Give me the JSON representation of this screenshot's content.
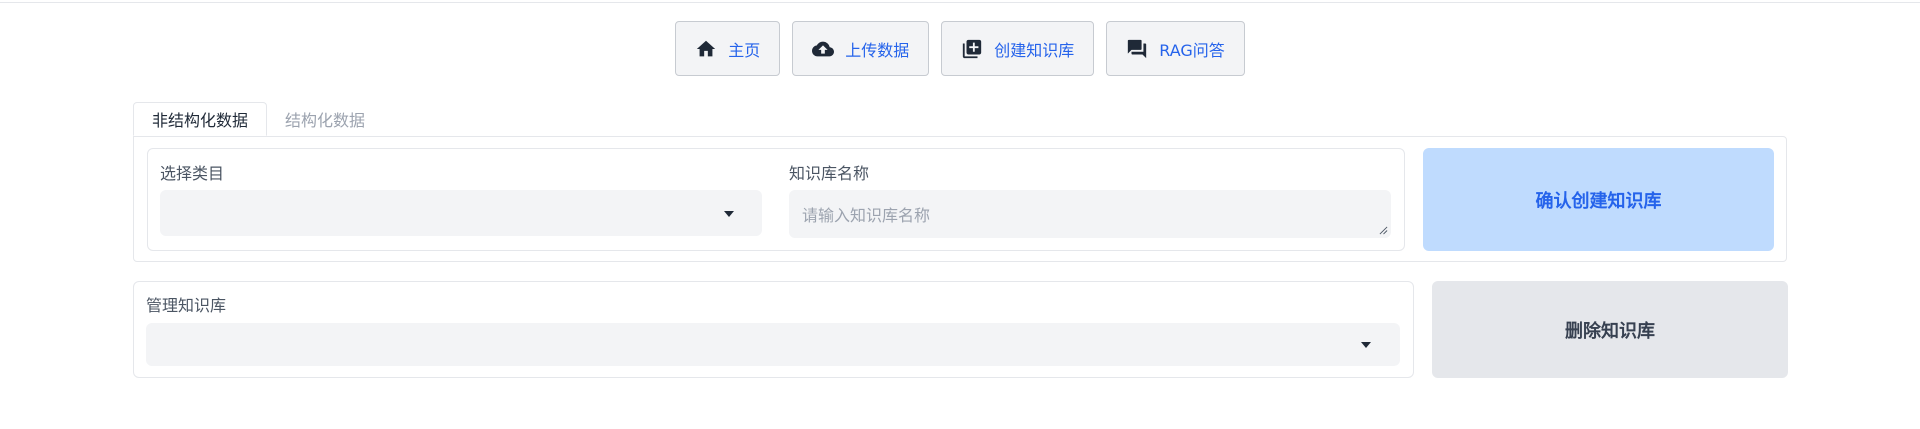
{
  "nav": {
    "items": [
      {
        "label": "主页",
        "icon": "home-icon"
      },
      {
        "label": "上传数据",
        "icon": "cloud-upload-icon"
      },
      {
        "label": "创建知识库",
        "icon": "library-add-icon"
      },
      {
        "label": "RAG问答",
        "icon": "forum-icon"
      }
    ]
  },
  "tabs": [
    {
      "label": "非结构化数据",
      "active": true
    },
    {
      "label": "结构化数据",
      "active": false
    }
  ],
  "create_form": {
    "category_label": "选择类目",
    "category_value": "",
    "kb_name_label": "知识库名称",
    "kb_name_placeholder": "请输入知识库名称",
    "confirm_label": "确认创建知识库"
  },
  "manage": {
    "label": "管理知识库",
    "value": "",
    "delete_label": "删除知识库"
  },
  "colors": {
    "accent": "#2563eb",
    "confirm_bg": "#bfdbfe",
    "delete_bg": "#e5e7eb",
    "input_bg": "#f3f4f6"
  }
}
